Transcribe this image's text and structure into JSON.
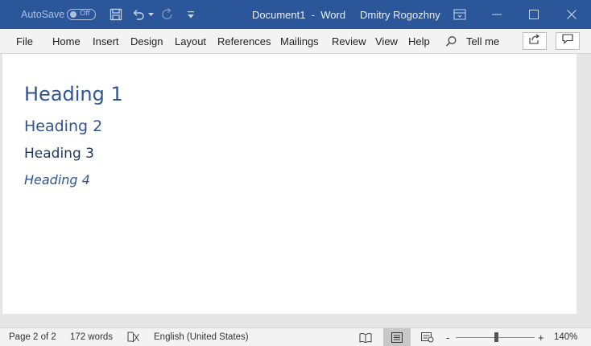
{
  "titlebar": {
    "autosave_label": "AutoSave",
    "autosave_state": "Off",
    "document_title": "Document1  -  Word",
    "user_name": "Dmitry Rogozhny",
    "bg_color": "#2b579a"
  },
  "ribbon": {
    "tabs": [
      "File",
      "Home",
      "Insert",
      "Design",
      "Layout",
      "References",
      "Mailings",
      "Review",
      "View",
      "Help"
    ],
    "tell_me": "Tell me"
  },
  "document": {
    "heading1": "Heading 1",
    "heading2": "Heading 2",
    "heading3": "Heading 3",
    "heading4": "Heading 4"
  },
  "statusbar": {
    "page_info": "Page 2 of 2",
    "word_count": "172 words",
    "language": "English (United States)",
    "zoom_minus": "-",
    "zoom_plus": "+",
    "zoom_level": "140%",
    "zoom_slider_fraction": 0.52
  }
}
